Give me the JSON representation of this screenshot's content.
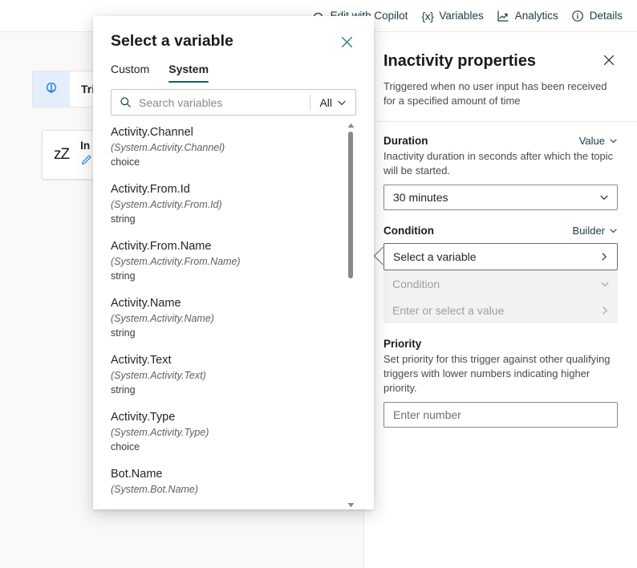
{
  "topbar": {
    "items": [
      {
        "label": "Edit with Copilot",
        "icon": "copilot-icon"
      },
      {
        "label": "Variables",
        "icon": "variables-braces-icon"
      },
      {
        "label": "Analytics",
        "icon": "analytics-chart-icon"
      },
      {
        "label": "Details",
        "icon": "info-circle-icon"
      }
    ]
  },
  "canvas": {
    "trigger_chip": {
      "label": "Tri",
      "icon": "trigger-bolt-icon"
    },
    "node": {
      "title": "In",
      "icon": "sleep-zzz-icon",
      "edit_icon": "pencil-edit-icon",
      "zzz": "zZ"
    }
  },
  "dialog": {
    "title": "Select a variable",
    "close_icon": "close-icon",
    "tabs": [
      {
        "label": "Custom",
        "active": false
      },
      {
        "label": "System",
        "active": true
      }
    ],
    "search": {
      "placeholder": "Search variables",
      "icon": "search-icon",
      "filter_label": "All",
      "filter_icon": "chevron-down-icon"
    },
    "scrollbar": {
      "up_icon": "scroll-up-arrow-icon",
      "down_icon": "scroll-down-arrow-icon",
      "thumb_position_pct": 0,
      "thumb_size_pct": 40
    },
    "variables": [
      {
        "name": "Activity.Channel",
        "path": "(System.Activity.Channel)",
        "type": "choice"
      },
      {
        "name": "Activity.From.Id",
        "path": "(System.Activity.From.Id)",
        "type": "string"
      },
      {
        "name": "Activity.From.Name",
        "path": "(System.Activity.From.Name)",
        "type": "string"
      },
      {
        "name": "Activity.Name",
        "path": "(System.Activity.Name)",
        "type": "string"
      },
      {
        "name": "Activity.Text",
        "path": "(System.Activity.Text)",
        "type": "string"
      },
      {
        "name": "Activity.Type",
        "path": "(System.Activity.Type)",
        "type": "choice"
      },
      {
        "name": "Bot.Name",
        "path": "(System.Bot.Name)",
        "type": ""
      }
    ]
  },
  "properties_pane": {
    "title": "Inactivity properties",
    "close_icon": "close-icon",
    "subtitle": "Triggered when no user input has been received for a specified amount of time",
    "duration": {
      "label": "Duration",
      "mode_label": "Value",
      "mode_icon": "chevron-down-icon",
      "description": "Inactivity duration in seconds after which the topic will be started.",
      "value": "30 minutes",
      "dropdown_icon": "chevron-down-icon"
    },
    "condition": {
      "label": "Condition",
      "mode_label": "Builder",
      "mode_icon": "chevron-down-icon",
      "variable_placeholder": "Select a variable",
      "variable_icon": "chevron-right-icon",
      "operator_placeholder": "Condition",
      "operator_icon": "chevron-down-icon",
      "value_placeholder": "Enter or select a value",
      "value_icon": "chevron-right-icon"
    },
    "priority": {
      "label": "Priority",
      "description": "Set priority for this trigger against other qualifying triggers with lower numbers indicating higher priority.",
      "placeholder": "Enter number"
    }
  },
  "colors": {
    "accent_teal": "#1a5c68",
    "link_teal": "#1b3b45",
    "trigger_tile": "#e3eefb",
    "canvas_bg": "#faf9f8",
    "disabled_bg": "#f3f2f1"
  }
}
